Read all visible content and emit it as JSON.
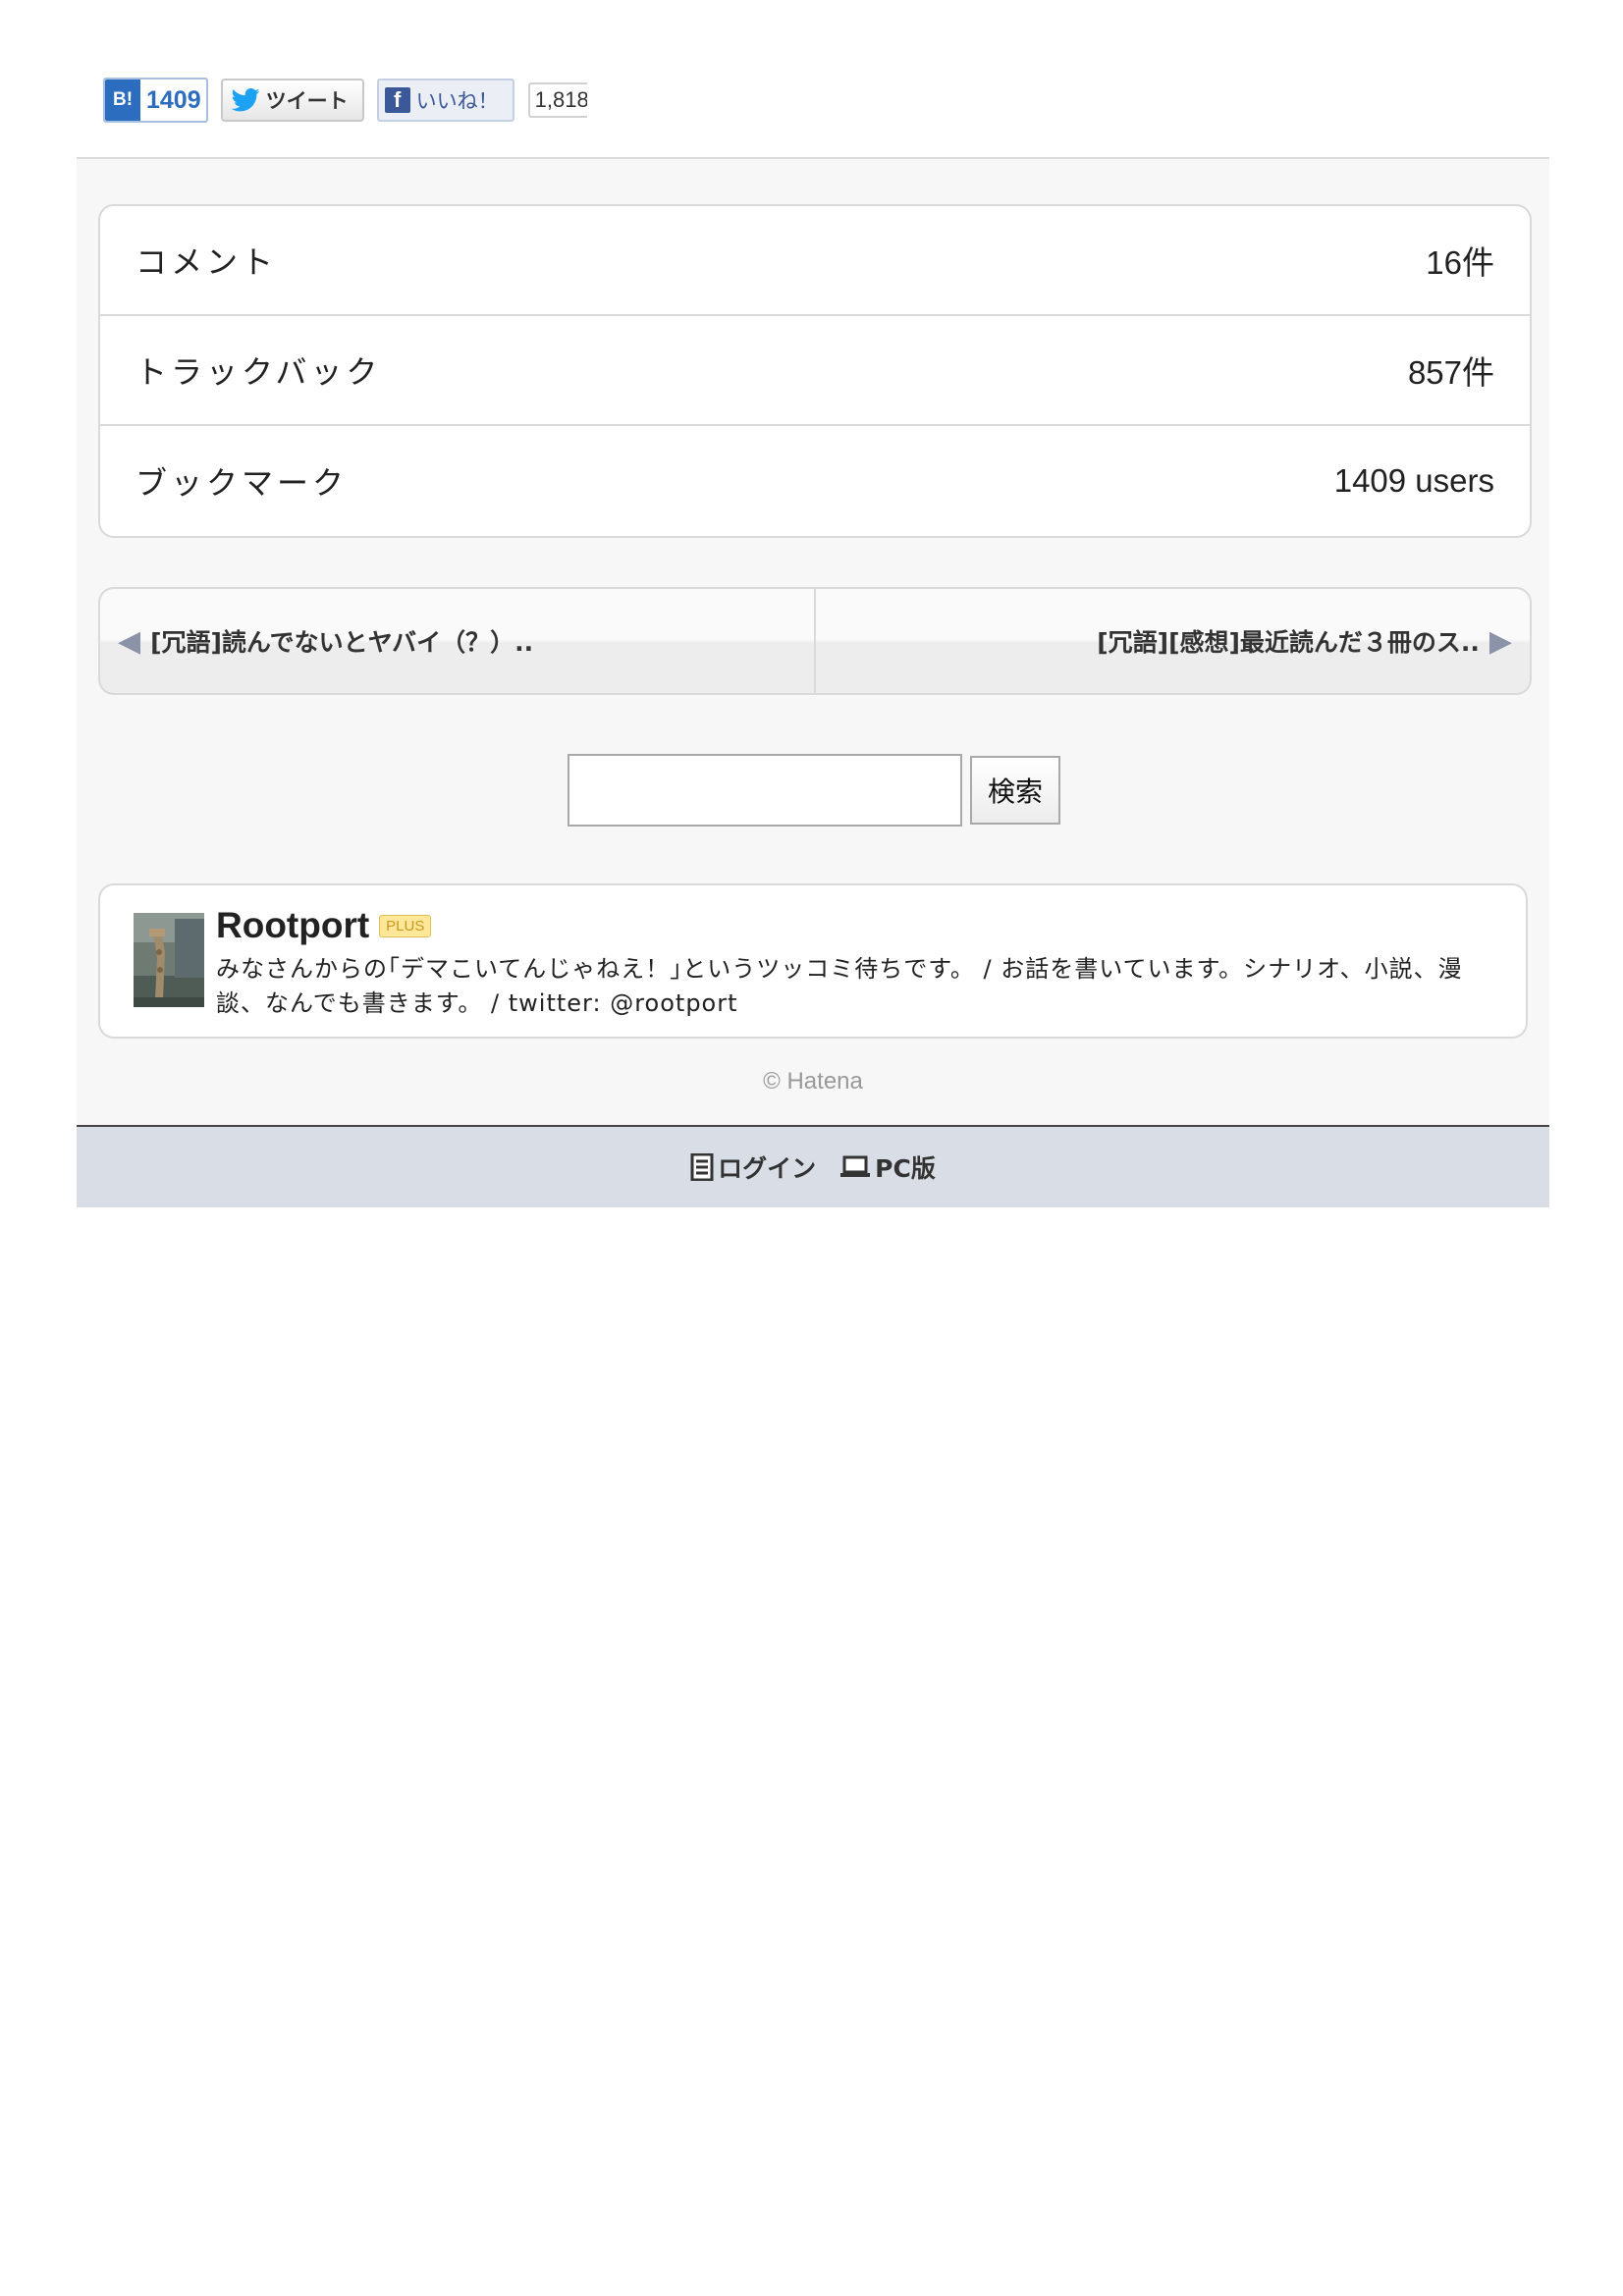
{
  "share": {
    "hatena_icon_text": "B!",
    "hatena_count": "1409",
    "tweet_label": "ツイート",
    "like_label": "いいね！",
    "like_count": "1,818"
  },
  "stats": [
    {
      "label": "コメント",
      "value": "16件"
    },
    {
      "label": "トラックバック",
      "value": "857件"
    },
    {
      "label": "ブックマーク",
      "value": "1409 users"
    }
  ],
  "pager": {
    "prev_title": "[冗語]読んでないとヤバイ（？）..",
    "next_title": "[冗語][感想]最近読んだ３冊のス.."
  },
  "search": {
    "value": "",
    "button_label": "検索"
  },
  "profile": {
    "name": "Rootport",
    "badge": "PLUS",
    "description": "みなさんからの｢デマこいてんじゃねえ！｣というツッコミ待ちです。 / お話を書いています。シナリオ、小説、漫談、なんでも書きます。 / twitter: @rootport"
  },
  "copyright": "© Hatena",
  "footer": {
    "login_label": "ログイン",
    "pc_label": "PC版"
  },
  "colors": {
    "hatena_blue": "#2d6dbf",
    "facebook_blue": "#3b5998",
    "twitter_blue": "#1da1f2",
    "footer_bg": "#d9dee6"
  }
}
